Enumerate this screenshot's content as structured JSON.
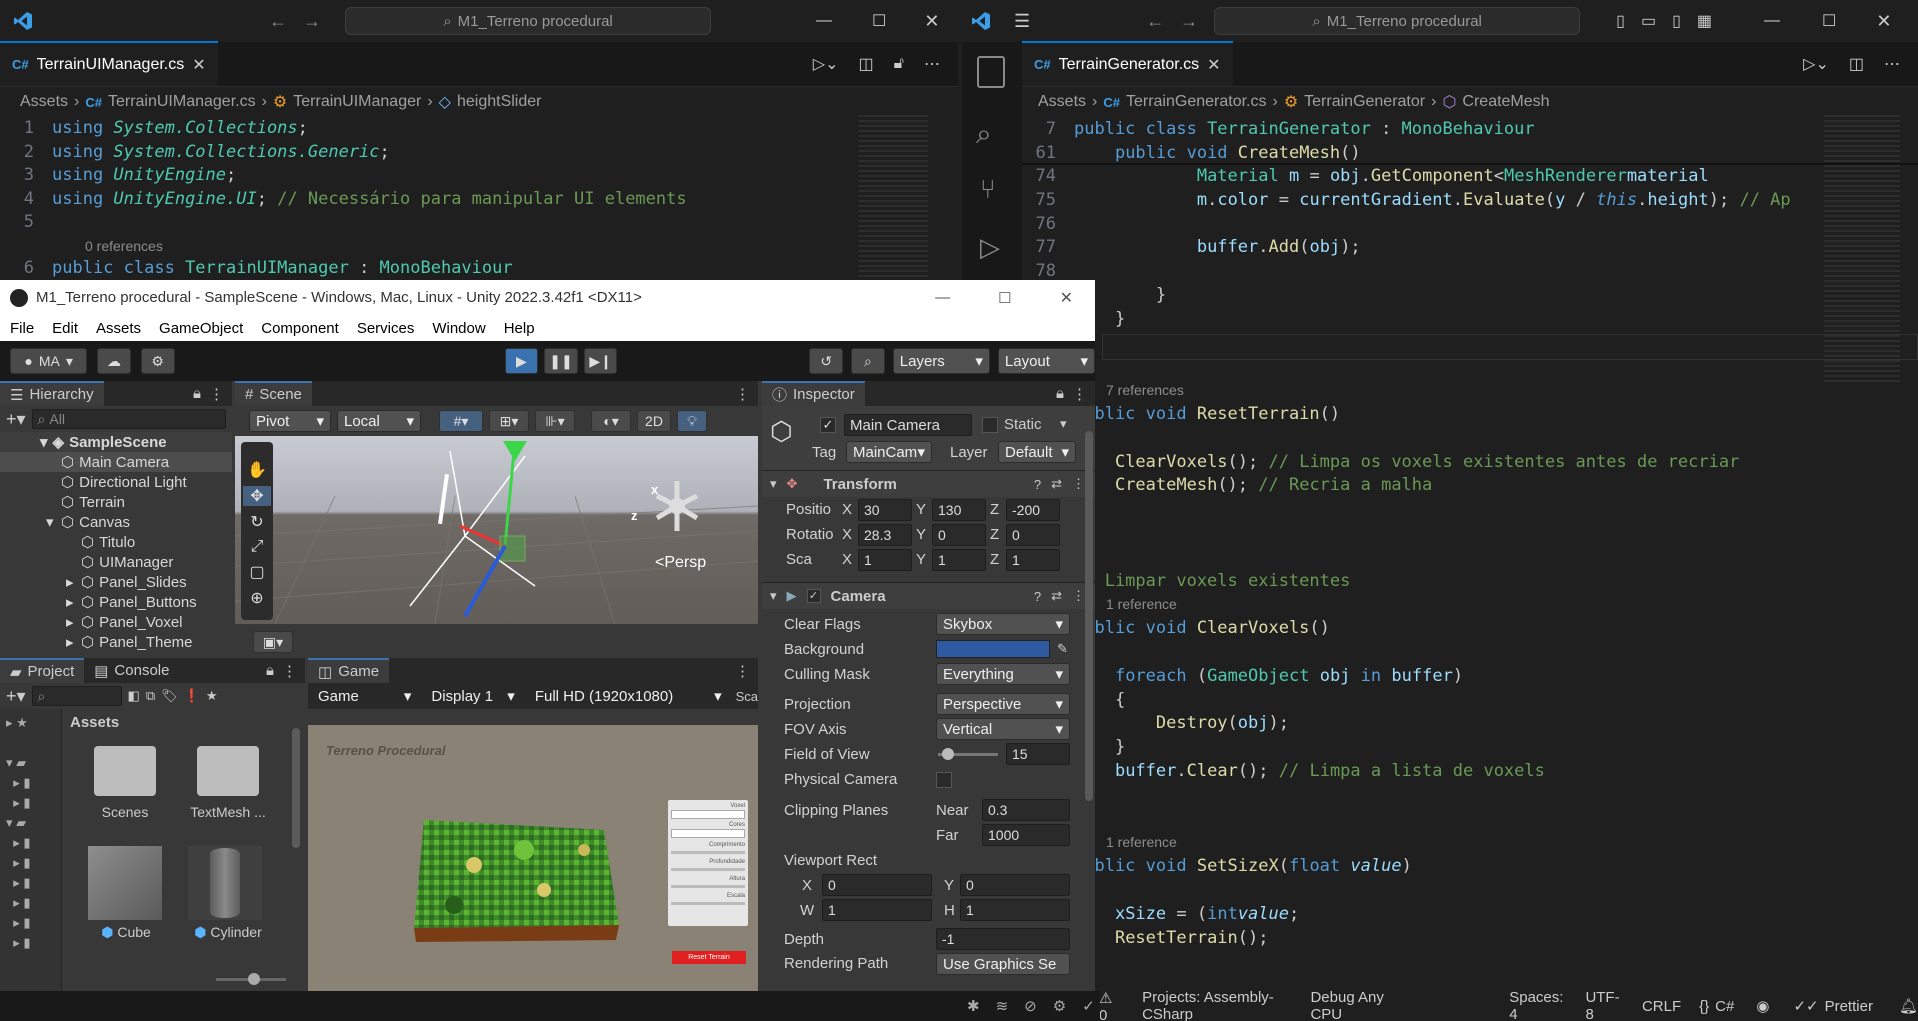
{
  "left_vscode": {
    "search": "M1_Terreno procedural",
    "tab": "TerrainUIManager.cs",
    "breadcrumb": [
      "Assets",
      "TerrainUIManager.cs",
      "TerrainUIManager",
      "heightSlider"
    ],
    "lines": [
      {
        "n": "1",
        "parts": [
          [
            "kw",
            "using "
          ],
          [
            "ty ital",
            "System.Collections"
          ],
          [
            "",
            "; "
          ]
        ]
      },
      {
        "n": "2",
        "parts": [
          [
            "kw",
            "using "
          ],
          [
            "ty ital",
            "System.Collections.Generic"
          ],
          [
            "",
            ";"
          ]
        ]
      },
      {
        "n": "3",
        "parts": [
          [
            "kw",
            "using "
          ],
          [
            "ty ital",
            "UnityEngine"
          ],
          [
            "",
            ";"
          ]
        ]
      },
      {
        "n": "4",
        "parts": [
          [
            "kw",
            "using "
          ],
          [
            "ty ital",
            "UnityEngine.UI"
          ],
          [
            "",
            "; "
          ],
          [
            "cm",
            "// Necessário para manipular UI elements"
          ]
        ]
      },
      {
        "n": "5",
        "parts": []
      },
      {
        "n": "",
        "ref": "0 references"
      },
      {
        "n": "6",
        "parts": [
          [
            "kw",
            "public class "
          ],
          [
            "ty",
            "TerrainUIManager"
          ],
          [
            "",
            " : "
          ],
          [
            "ty",
            "MonoBehaviour"
          ]
        ]
      }
    ]
  },
  "right_vscode": {
    "search": "M1_Terreno procedural",
    "tab": "TerrainGenerator.cs",
    "breadcrumb": [
      "Assets",
      "TerrainGenerator.cs",
      "TerrainGenerator",
      "CreateMesh"
    ],
    "sticky": [
      {
        "n": "7",
        "parts": [
          [
            "kw",
            "public class "
          ],
          [
            "ty",
            "TerrainGenerator"
          ],
          [
            "",
            " : "
          ],
          [
            "ty",
            "MonoBehaviour"
          ]
        ]
      },
      {
        "n": "61",
        "parts": [
          [
            "",
            "    "
          ],
          [
            "kw",
            "public void "
          ],
          [
            "fn",
            "CreateMesh"
          ],
          [
            "",
            "()"
          ]
        ]
      }
    ],
    "lines": [
      {
        "n": "74",
        "parts": [
          [
            "",
            "            "
          ],
          [
            "ty",
            "Material"
          ],
          [
            "",
            " "
          ],
          [
            "var",
            "m"
          ],
          [
            "",
            " = "
          ],
          [
            "var",
            "obj"
          ],
          [
            "",
            "."
          ],
          [
            "fn",
            "GetComponent"
          ],
          [
            "",
            "<"
          ],
          [
            "ty",
            "MeshRenderer"
          ],
          [
            ">()."
          ],
          [
            "var",
            "material"
          ],
          [
            ";"
          ]
        ]
      },
      {
        "n": "75",
        "parts": [
          [
            "",
            "            "
          ],
          [
            "var",
            "m"
          ],
          [
            "",
            "."
          ],
          [
            "var",
            "color"
          ],
          [
            "",
            " = "
          ],
          [
            "var",
            "currentGradient"
          ],
          [
            "",
            "."
          ],
          [
            "fn",
            "Evaluate"
          ],
          [
            "",
            "("
          ],
          [
            "var",
            "y"
          ],
          [
            "",
            " / "
          ],
          [
            "kw ital",
            "this"
          ],
          [
            "",
            "."
          ],
          [
            "var",
            "height"
          ],
          [
            "",
            "); "
          ],
          [
            "cm",
            "// Ap"
          ]
        ]
      },
      {
        "n": "76",
        "parts": []
      },
      {
        "n": "77",
        "parts": [
          [
            "",
            "            "
          ],
          [
            "var",
            "buffer"
          ],
          [
            "",
            "."
          ],
          [
            "fn",
            "Add"
          ],
          [
            "",
            "("
          ],
          [
            "var",
            "obj"
          ],
          [
            "",
            ");"
          ]
        ]
      },
      {
        "n": "78",
        "parts": []
      },
      {
        "n": "",
        "parts": [
          [
            "",
            "        }"
          ]
        ]
      },
      {
        "n": "",
        "parts": [
          [
            "",
            "    }"
          ]
        ]
      },
      {
        "n": "",
        "parts": [
          [
            "",
            "}"
          ]
        ]
      },
      {
        "n": "",
        "parts": []
      },
      {
        "n": "",
        "ref": "7 references"
      },
      {
        "n": "",
        "parts": [
          [
            "kw",
            "public void "
          ],
          [
            "fn",
            "ResetTerrain"
          ],
          [
            "",
            "()"
          ]
        ]
      },
      {
        "n": "",
        "parts": [
          [
            "",
            "{"
          ]
        ]
      },
      {
        "n": "",
        "parts": [
          [
            "",
            "    "
          ],
          [
            "fn",
            "ClearVoxels"
          ],
          [
            "",
            "(); "
          ],
          [
            "cm",
            "// Limpa os voxels existentes antes de recriar"
          ]
        ]
      },
      {
        "n": "",
        "parts": [
          [
            "",
            "    "
          ],
          [
            "fn",
            "CreateMesh"
          ],
          [
            "",
            "(); "
          ],
          [
            "cm",
            "// Recria a malha"
          ]
        ]
      },
      {
        "n": "",
        "parts": [
          [
            "",
            "}"
          ]
        ]
      },
      {
        "n": "",
        "parts": []
      },
      {
        "n": "",
        "parts": []
      },
      {
        "n": "",
        "parts": [
          [
            "cm",
            "// Limpar voxels existentes"
          ]
        ]
      },
      {
        "n": "",
        "ref": "1 reference"
      },
      {
        "n": "",
        "parts": [
          [
            "kw",
            "public void "
          ],
          [
            "fn",
            "ClearVoxels"
          ],
          [
            "",
            "()"
          ]
        ]
      },
      {
        "n": "",
        "parts": [
          [
            "",
            "{"
          ]
        ]
      },
      {
        "n": "",
        "parts": [
          [
            "",
            "    "
          ],
          [
            "kw",
            "foreach "
          ],
          [
            "",
            "("
          ],
          [
            "ty",
            "GameObject"
          ],
          [
            "",
            " "
          ],
          [
            "var",
            "obj"
          ],
          [
            "",
            " "
          ],
          [
            "kw",
            "in "
          ],
          [
            "var",
            "buffer"
          ],
          [
            "",
            ")"
          ]
        ]
      },
      {
        "n": "",
        "parts": [
          [
            "",
            "    {"
          ]
        ]
      },
      {
        "n": "",
        "parts": [
          [
            "",
            "        "
          ],
          [
            "fn",
            "Destroy"
          ],
          [
            "",
            "("
          ],
          [
            "var",
            "obj"
          ],
          [
            "",
            ");"
          ]
        ]
      },
      {
        "n": "",
        "parts": [
          [
            "",
            "    }"
          ]
        ]
      },
      {
        "n": "",
        "parts": [
          [
            "",
            "    "
          ],
          [
            "var",
            "buffer"
          ],
          [
            "",
            "."
          ],
          [
            "fn",
            "Clear"
          ],
          [
            "",
            "(); "
          ],
          [
            "cm",
            "// Limpa a lista de voxels"
          ]
        ]
      },
      {
        "n": "",
        "parts": [
          [
            "",
            "}"
          ]
        ]
      },
      {
        "n": "",
        "parts": []
      },
      {
        "n": "",
        "ref": "1 reference"
      },
      {
        "n": "",
        "parts": [
          [
            "kw",
            "public void "
          ],
          [
            "fn",
            "SetSizeX"
          ],
          [
            "",
            "("
          ],
          [
            "kw",
            "float "
          ],
          [
            "var ital",
            "value"
          ],
          [
            "",
            ")"
          ]
        ]
      },
      {
        "n": "",
        "parts": [
          [
            "",
            "{"
          ]
        ]
      },
      {
        "n": "",
        "parts": [
          [
            "",
            "    "
          ],
          [
            "var",
            "xSize"
          ],
          [
            "",
            " = ("
          ],
          [
            "kw",
            "int"
          ],
          [
            ")"
          ],
          [
            "var ital",
            "value"
          ],
          [
            "",
            ";"
          ]
        ]
      },
      {
        "n": "",
        "parts": [
          [
            "",
            "    "
          ],
          [
            "fn",
            "ResetTerrain"
          ],
          [
            "",
            "();"
          ]
        ]
      },
      {
        "n": "",
        "parts": [
          [
            "",
            "}"
          ]
        ]
      }
    ],
    "status": {
      "errors": "0",
      "project": "Projects: Assembly-CSharp",
      "config": "Debug Any CPU",
      "spaces": "Spaces: 4",
      "encoding": "UTF-8",
      "eol": "CRLF",
      "lang": "C#",
      "formatter": "Prettier"
    }
  },
  "unity": {
    "title": "M1_Terreno procedural - SampleScene - Windows, Mac, Linux - Unity 2022.3.42f1 <DX11>",
    "menu": [
      "File",
      "Edit",
      "Assets",
      "GameObject",
      "Component",
      "Services",
      "Window",
      "Help"
    ],
    "account": "MA",
    "layers": "Layers",
    "layout": "Layout",
    "hierarchy": {
      "title": "Hierarchy",
      "search": "All",
      "scene": "SampleScene",
      "items": [
        {
          "label": "Main Camera",
          "indent": 1,
          "selected": true
        },
        {
          "label": "Directional Light",
          "indent": 1
        },
        {
          "label": "Terrain",
          "indent": 1
        },
        {
          "label": "Canvas",
          "indent": 1,
          "expand": true
        },
        {
          "label": "Titulo",
          "indent": 2
        },
        {
          "label": "UIManager",
          "indent": 2
        },
        {
          "label": "Panel_Slides",
          "indent": 2,
          "arrow": true
        },
        {
          "label": "Panel_Buttons",
          "indent": 2,
          "arrow": true
        },
        {
          "label": "Panel_Voxel",
          "indent": 2,
          "arrow": true
        },
        {
          "label": "Panel_Theme",
          "indent": 2,
          "arrow": true
        }
      ]
    },
    "scene": {
      "title": "Scene",
      "pivot": "Pivot",
      "local": "Local",
      "mode2d": "2D",
      "persp": "<Persp"
    },
    "inspector": {
      "title": "Inspector",
      "object": "Main Camera",
      "static": "Static",
      "tag_label": "Tag",
      "tag": "MainCam",
      "layer_label": "Layer",
      "layer": "Default",
      "transform": "Transform",
      "position_label": "Positio",
      "position": [
        "30",
        "130",
        "-200"
      ],
      "rotation_label": "Rotatio",
      "rotation": [
        "28.3",
        "0",
        "0"
      ],
      "scale_label": "Sca",
      "scale": [
        "1",
        "1",
        "1"
      ],
      "camera": "Camera",
      "rows": [
        {
          "label": "Clear Flags",
          "value": "Skybox",
          "kind": "drop"
        },
        {
          "label": "Background",
          "value": "",
          "kind": "color"
        },
        {
          "label": "Culling Mask",
          "value": "Everything",
          "kind": "drop"
        },
        {
          "label": "Projection",
          "value": "Perspective",
          "kind": "drop"
        },
        {
          "label": "FOV Axis",
          "value": "Vertical",
          "kind": "drop"
        },
        {
          "label": "Field of View",
          "value": "15",
          "kind": "slider"
        },
        {
          "label": "Physical Camera",
          "value": "",
          "kind": "check"
        }
      ],
      "clipping_label": "Clipping Planes",
      "near_label": "Near",
      "near": "0.3",
      "far_label": "Far",
      "far": "1000",
      "viewport_label": "Viewport Rect",
      "vx": "0",
      "vy": "0",
      "vw": "1",
      "vh": "1",
      "depth_label": "Depth",
      "depth": "-1",
      "rendering_label": "Rendering Path",
      "rendering": "Use Graphics Se"
    },
    "project": {
      "tab1": "Project",
      "tab2": "Console",
      "assets": "Assets",
      "items": [
        "Scenes",
        "TextMesh ...",
        "Cube",
        "Cylinder"
      ]
    },
    "game": {
      "title": "Game",
      "mode": "Game",
      "display": "Display 1",
      "resolution": "Full HD (1920x1080)",
      "scale": "Sca",
      "overlay_title": "Terreno Procedural",
      "ui_labels": [
        "Voxel",
        "Cubo",
        "Cores",
        "Padrão",
        "Comprimento",
        "Profundidade",
        "Altura",
        "Escala"
      ],
      "reset": "Reset Terrain"
    },
    "colors": {
      "background_swatch": "#2d5aa0",
      "play_active": "#3a72b0"
    }
  }
}
